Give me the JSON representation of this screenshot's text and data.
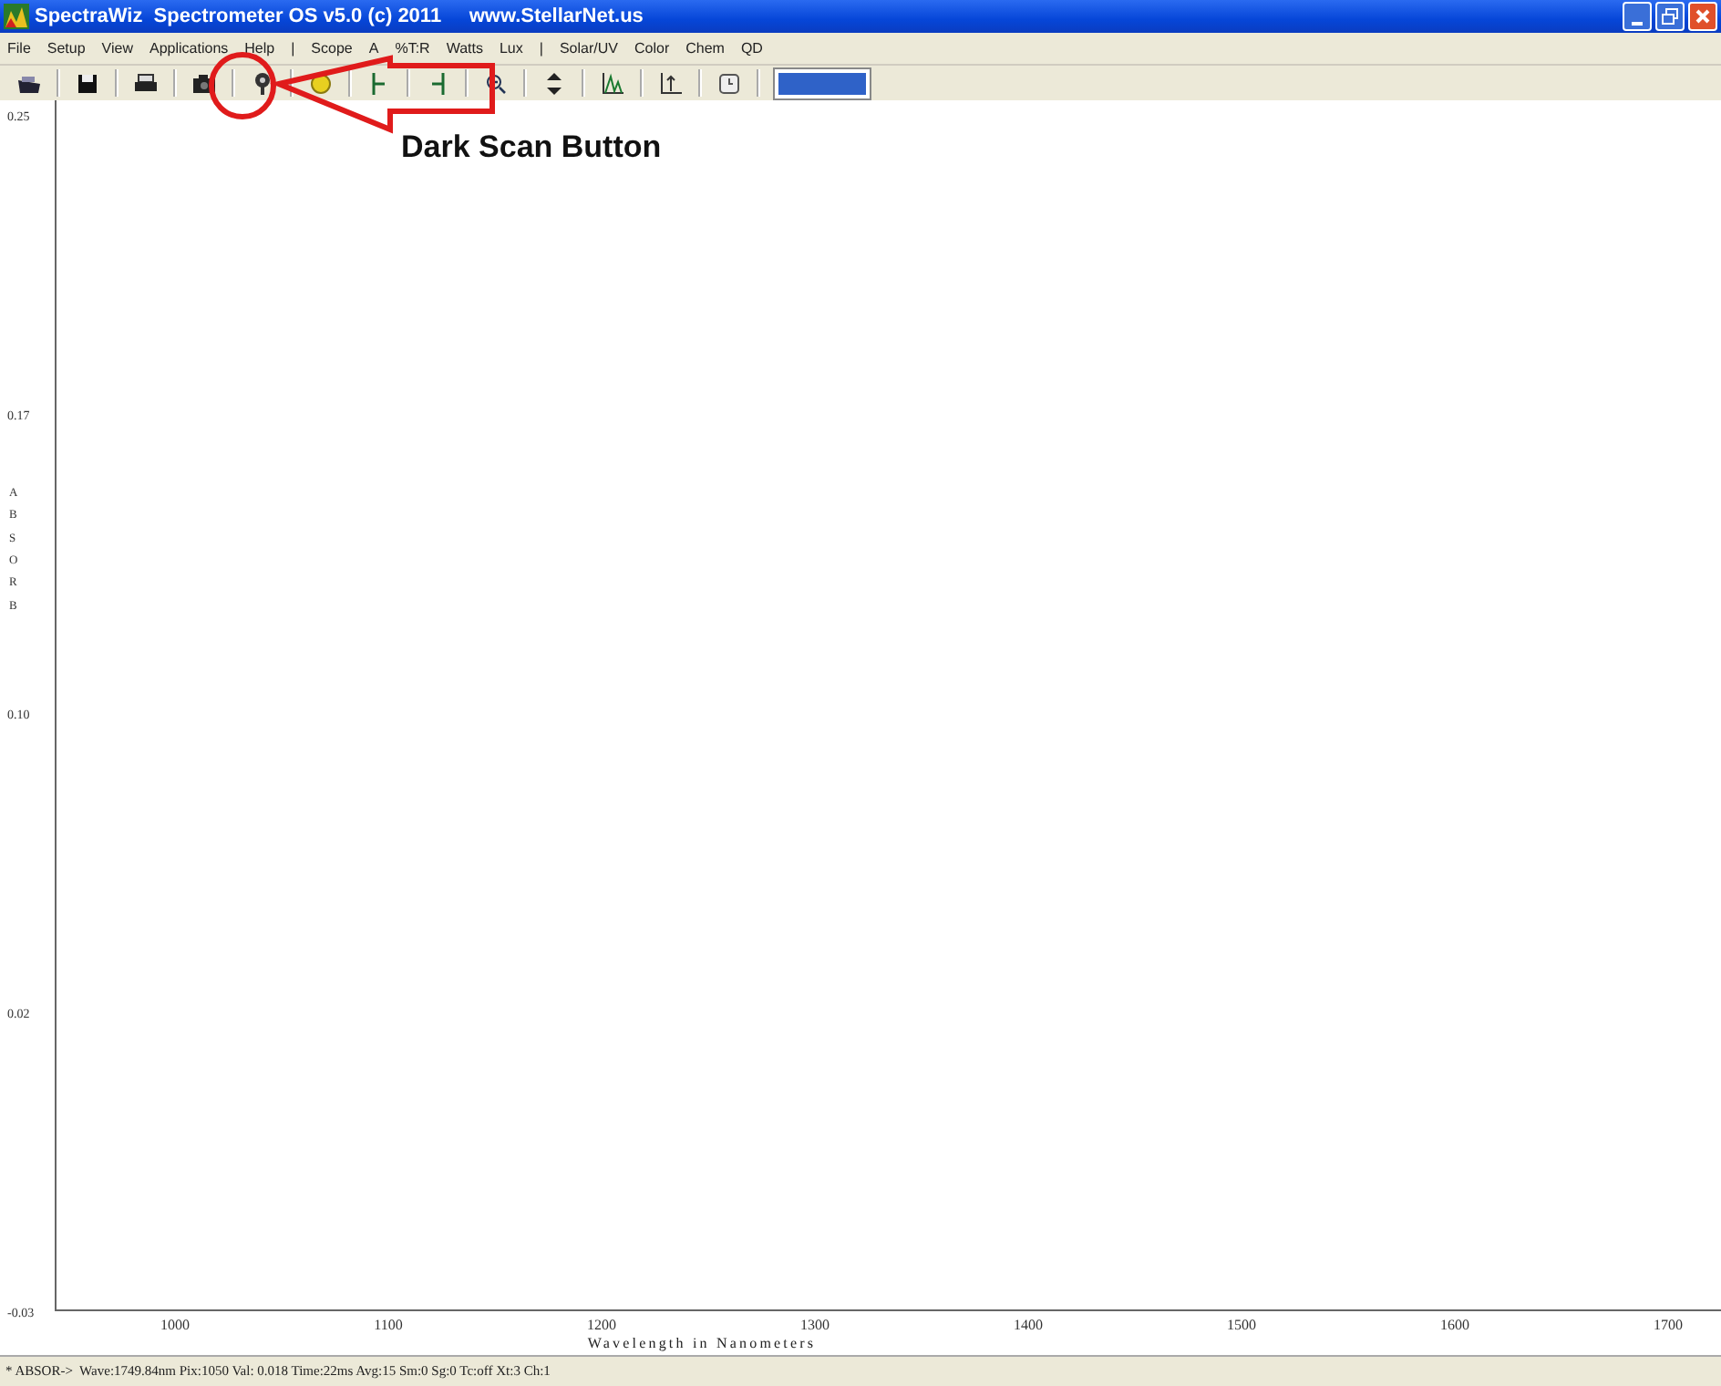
{
  "window": {
    "title": "SpectraWiz  Spectrometer OS v5.0 (c) 2011     www.StellarNet.us"
  },
  "menu": [
    "File",
    "Setup",
    "View",
    "Applications",
    "Help",
    "|",
    "Scope",
    "A",
    "%T:R",
    "Watts",
    "Lux",
    "|",
    "Solar/UV",
    "Color",
    "Chem",
    "QD"
  ],
  "plot": {
    "yticks": [
      "0.25",
      "0.17",
      "0.10",
      "0.02",
      "-0.03"
    ],
    "ylabel": "ABSORB",
    "xticks": [
      "1000",
      "1100",
      "1200",
      "1300",
      "1400",
      "1500",
      "1600",
      "1700"
    ],
    "xlabel": "Wavelength in Nanometers"
  },
  "annotation": {
    "label": "Dark Scan Button"
  },
  "status_bar": "* ABSOR->  Wave:1749.84nm Pix:1050 Val: 0.018 Time:22ms Avg:15 Sm:0 Sg:0 Tc:off Xt:3 Ch:1"
}
